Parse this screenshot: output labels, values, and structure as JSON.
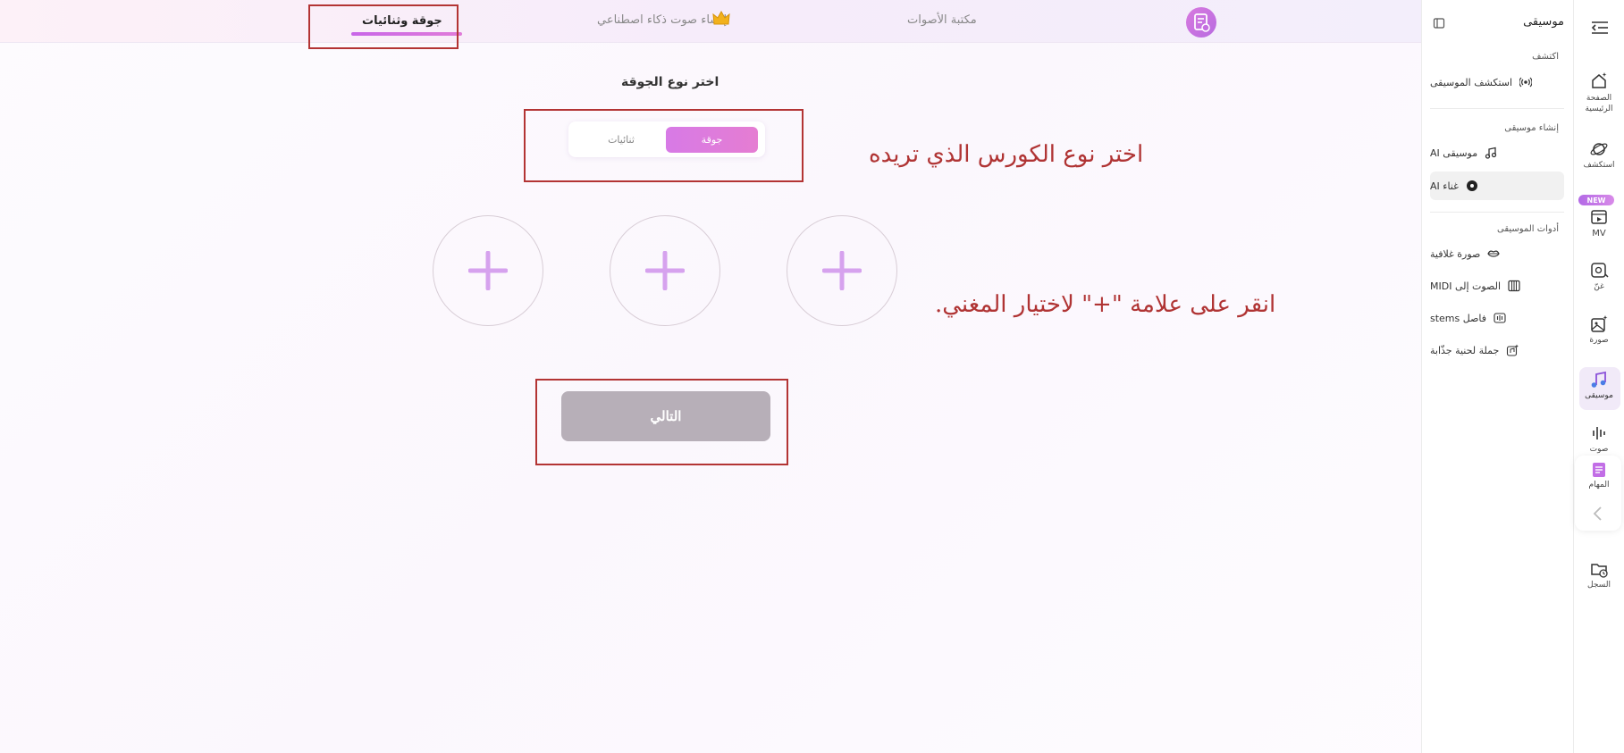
{
  "top_tabs": {
    "chorus_duets": "جوقة وثنائيات",
    "ai_voice": "إنشاء صوت ذكاء اصطناعي",
    "voice_library": "مكتبة الأصوات"
  },
  "main": {
    "choose_title": "اختر نوع الجوقة",
    "segment_chorus": "جوقة",
    "segment_duets": "ثنائيات",
    "plus_glyph": "+",
    "next_button": "التالي"
  },
  "annotations": {
    "choose_course": "اختر نوع الكورس الذي تريده",
    "click_plus": "انقر على علامة \"+\" لاختيار المغني."
  },
  "side_panel": {
    "title": "موسيقى",
    "discover_label": "اكتشف",
    "discover_music": "استكشف الموسيقى",
    "create_label": "إنشاء موسيقى",
    "ai_music": "موسيقى AI",
    "ai_singer": "غناء AI",
    "tools_label": "أدوات الموسيقى",
    "album_art": "صورة غلافية",
    "audio_to_midi": "الصوت إلى MIDI",
    "stem_split": "فاصل stems",
    "catchy_hook": "جملة لحنية جذّابة"
  },
  "rail": {
    "home": "الصفحة الرئيسية",
    "explore": "استكشف",
    "new_badge": "NEW",
    "mv": "MV",
    "sing": "غنّ",
    "image": "صورة",
    "music": "موسيقى",
    "voice": "صوت",
    "tasks": "المهام",
    "history": "السجل"
  },
  "colors": {
    "accent_gradient_start": "#d77ae6",
    "accent_gradient_end": "#e57dd2",
    "annotation_red": "#b33434",
    "next_button_bg": "#b7afb8"
  }
}
